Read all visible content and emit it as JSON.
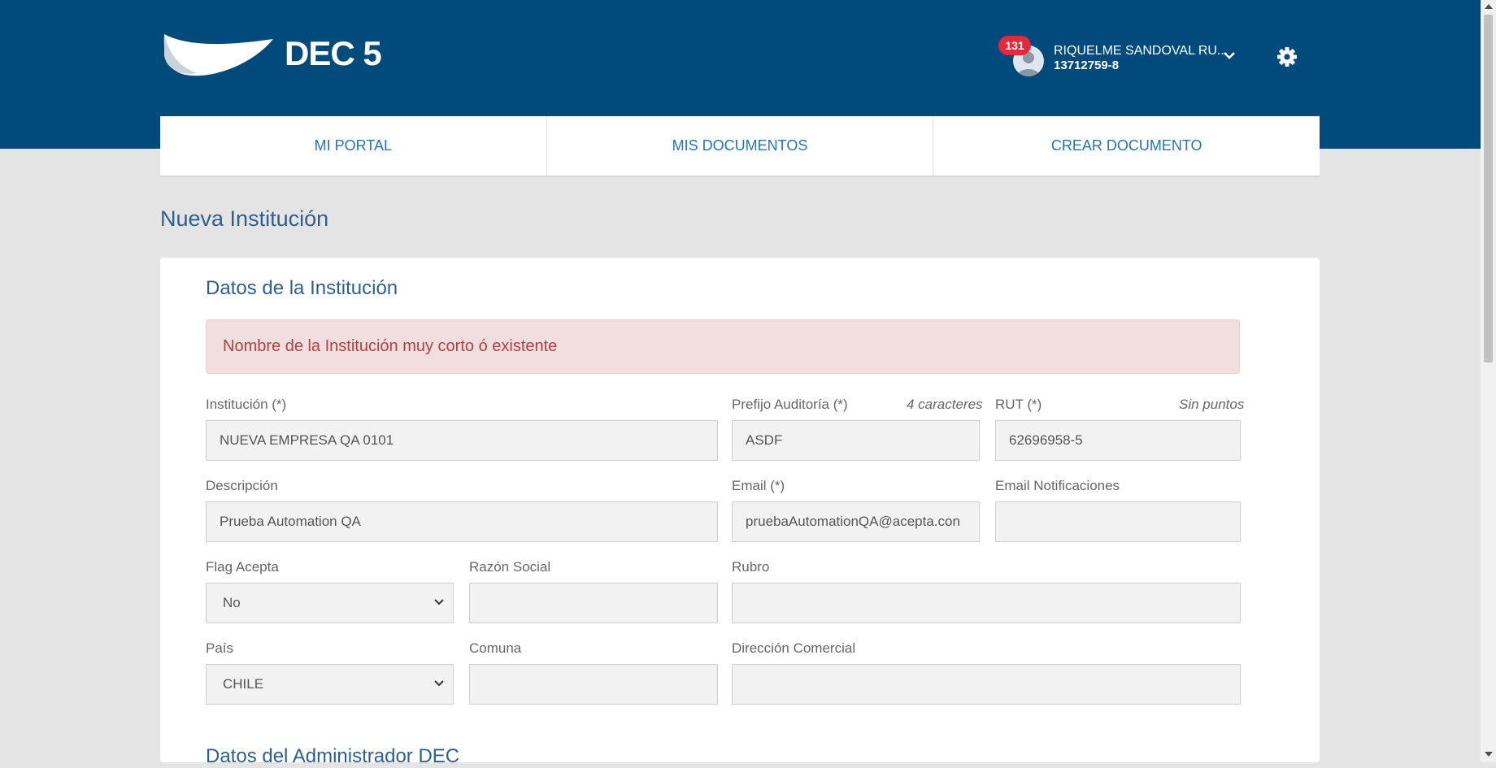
{
  "header": {
    "logo_text": "DEC 5",
    "notification_count": "131",
    "user_name": "RIQUELME SANDOVAL RU...",
    "user_rut": "13712759-8"
  },
  "nav": {
    "items": [
      {
        "label": "MI PORTAL"
      },
      {
        "label": "MIS DOCUMENTOS"
      },
      {
        "label": "CREAR DOCUMENTO"
      }
    ]
  },
  "page": {
    "title": "Nueva Institución",
    "section_title": "Datos de la Institución",
    "alert": "Nombre de la Institución muy corto ó existente",
    "next_section_title": "Datos del Administrador DEC"
  },
  "form": {
    "institucion": {
      "label": "Institución (*)",
      "value": "NUEVA EMPRESA QA 0101"
    },
    "prefijo": {
      "label": "Prefijo Auditoría (*)",
      "hint": "4 caracteres",
      "value": "ASDF"
    },
    "rut": {
      "label": "RUT (*)",
      "hint": "Sin puntos",
      "value": "62696958-5"
    },
    "descripcion": {
      "label": "Descripción",
      "value": "Prueba Automation QA"
    },
    "email": {
      "label": "Email (*)",
      "value": "pruebaAutomationQA@acepta.con"
    },
    "email_notificaciones": {
      "label": "Email Notificaciones",
      "value": ""
    },
    "flag_acepta": {
      "label": "Flag Acepta",
      "value": "No"
    },
    "razon_social": {
      "label": "Razón Social",
      "value": ""
    },
    "rubro": {
      "label": "Rubro",
      "value": ""
    },
    "pais": {
      "label": "País",
      "value": "CHILE"
    },
    "comuna": {
      "label": "Comuna",
      "value": ""
    },
    "direccion": {
      "label": "Dirección Comercial",
      "value": ""
    }
  },
  "colors": {
    "header_bg": "#004a7c",
    "nav_link": "#2474b6",
    "title": "#2d5f8f",
    "alert_bg": "#f2dede",
    "alert_text": "#a94442",
    "badge": "#e5283c"
  },
  "icons": {
    "logo": "wave-logo-icon",
    "avatar": "user-avatar-icon",
    "dropdown": "chevron-down-icon",
    "settings": "gear-icon"
  }
}
